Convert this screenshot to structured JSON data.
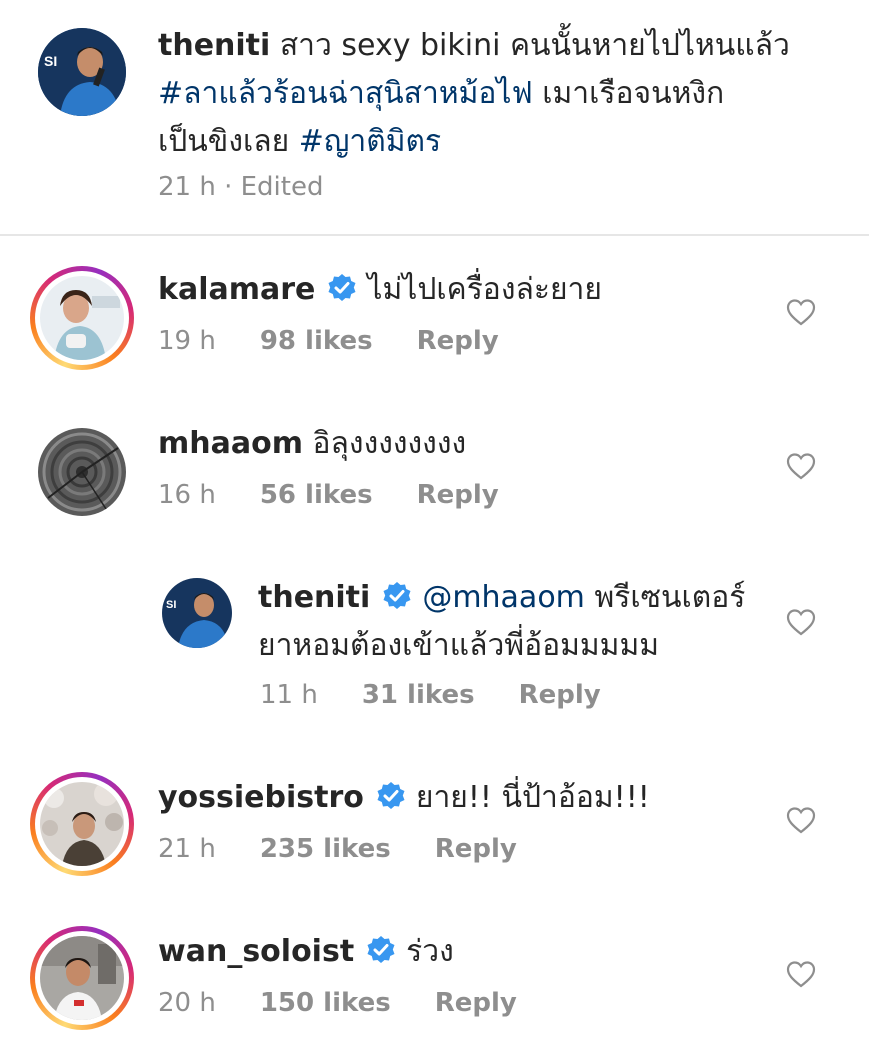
{
  "caption": {
    "username": "theniti",
    "text_line1": "สาว sexy bikini คนนั้นหายไปไหนแล้ว",
    "hashtag1": "#ลาแล้วร้อนฉ่าสุนิสาหม้อไฟ",
    "text_line2_rest": " เมาเรือจนหงิก",
    "text_line3": "เป็นขิงเลย ",
    "hashtag2": "#ญาติมิตร",
    "time": "21 h",
    "edited": "· Edited"
  },
  "comments": [
    {
      "username": "kalamare",
      "verified": true,
      "text": "ไม่ไปเครื่องล่ะยาย",
      "time": "19 h",
      "likes": "98 likes",
      "reply": "Reply"
    },
    {
      "username": "mhaaom",
      "verified": false,
      "text": "อิลุงงงงงงงง",
      "time": "16 h",
      "likes": "56 likes",
      "reply": "Reply"
    },
    {
      "username": "theniti",
      "verified": true,
      "mention": "@mhaaom",
      "text_line1": " พรีเซนเตอร์",
      "text_line2": "ยาหอมต้องเข้าแล้วพี่อ้อมมมมม",
      "time": "11 h",
      "likes": "31 likes",
      "reply": "Reply"
    },
    {
      "username": "yossiebistro",
      "verified": true,
      "text": "ยาย!! นี่ป้าอ้อม!!!",
      "time": "21 h",
      "likes": "235 likes",
      "reply": "Reply"
    },
    {
      "username": "wan_soloist",
      "verified": true,
      "text": "ร่วง",
      "time": "20 h",
      "likes": "150 likes",
      "reply": "Reply"
    }
  ],
  "icons": {
    "verified": "verified-badge-icon",
    "like": "heart-icon"
  },
  "colors": {
    "hashtag": "#003569",
    "verified": "#3897f0",
    "meta": "#8e8e8e"
  }
}
